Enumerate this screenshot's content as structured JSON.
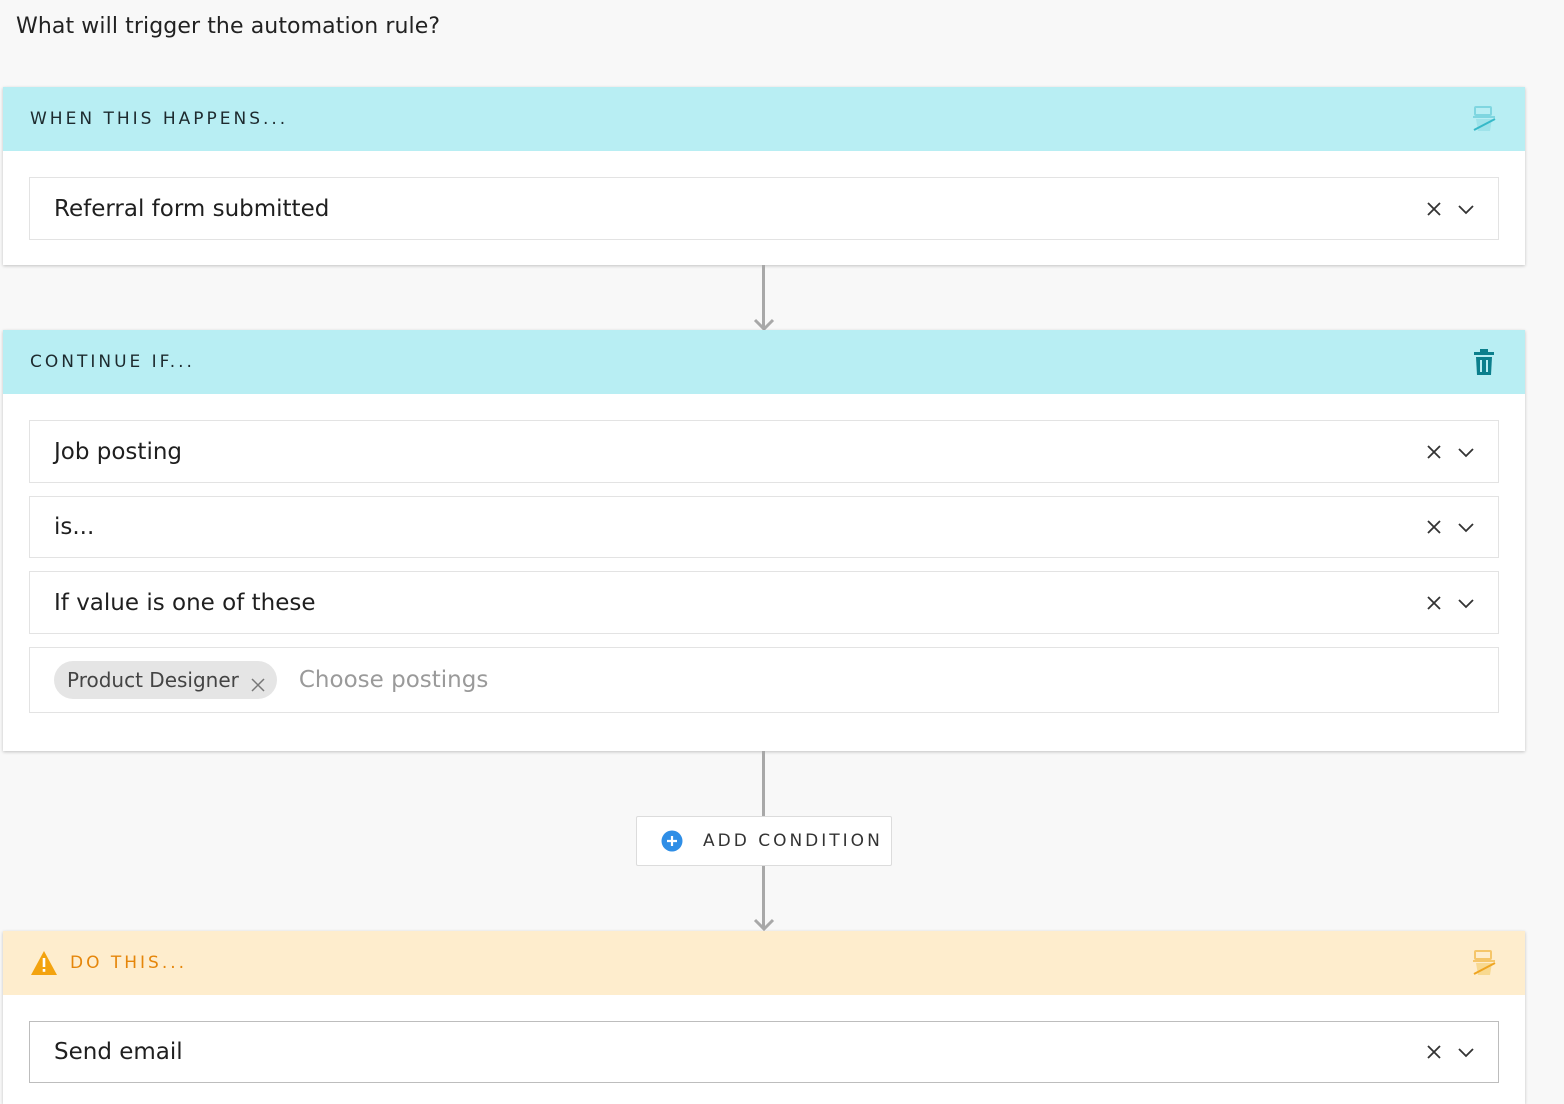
{
  "question": "What will trigger the automation rule?",
  "trigger_card": {
    "title": "WHEN THIS HAPPENS...",
    "header_icon": "eraser-icon",
    "field_value": "Referral form submitted"
  },
  "condition_card": {
    "title": "CONTINUE IF...",
    "header_icon": "trash-icon",
    "fields": [
      {
        "value": "Job posting"
      },
      {
        "value": "is..."
      },
      {
        "value": "If value is one of these"
      }
    ],
    "tag_field": {
      "tags": [
        "Product Designer"
      ],
      "placeholder": "Choose postings"
    }
  },
  "add_condition": {
    "label": "ADD CONDITION",
    "icon": "plus-circle-icon"
  },
  "action_card": {
    "title": "DO THIS...",
    "status_icon": "warning-icon",
    "header_icon": "eraser-icon",
    "field_value": "Send email"
  },
  "colors": {
    "cyan_header": "#b8eef3",
    "amber_header": "#feedcd",
    "amber_text": "#e5860a",
    "trash_teal": "#0b7f8c",
    "plus_blue": "#2f8ee6"
  }
}
